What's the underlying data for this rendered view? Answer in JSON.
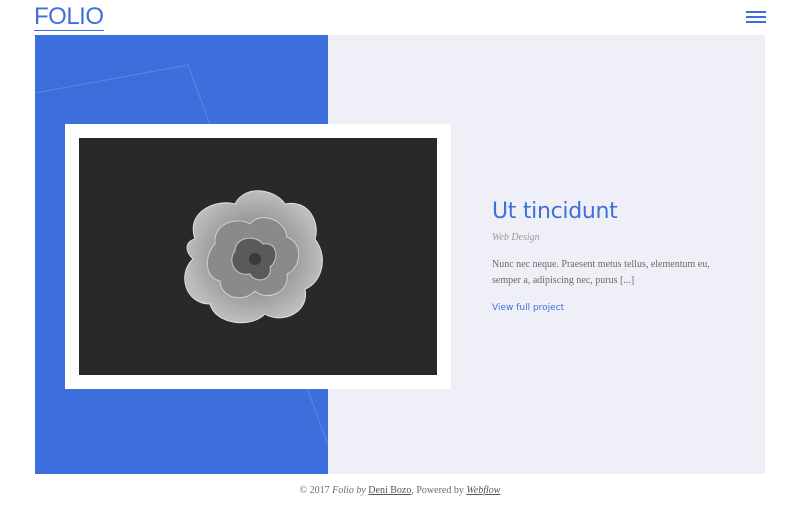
{
  "header": {
    "logo": "FOLIO",
    "menu_icon": "hamburger-menu-icon"
  },
  "project": {
    "title": "Ut tincidunt",
    "category": "Web Design",
    "description": "Nunc nec neque. Praesent metus tellus, elementum eu, semper a, adipiscing nec, purus [...]",
    "link_label": "View full project",
    "image_alt": "flower"
  },
  "footer": {
    "prefix": "© 2017 ",
    "folio": "Folio",
    "by": " by ",
    "author": "Deni Bozo",
    "powered": ", Powered by ",
    "platform": "Webflow"
  },
  "colors": {
    "accent": "#3d6fdc",
    "panel_bg": "#eff0f7",
    "photo_bg": "#292929"
  }
}
